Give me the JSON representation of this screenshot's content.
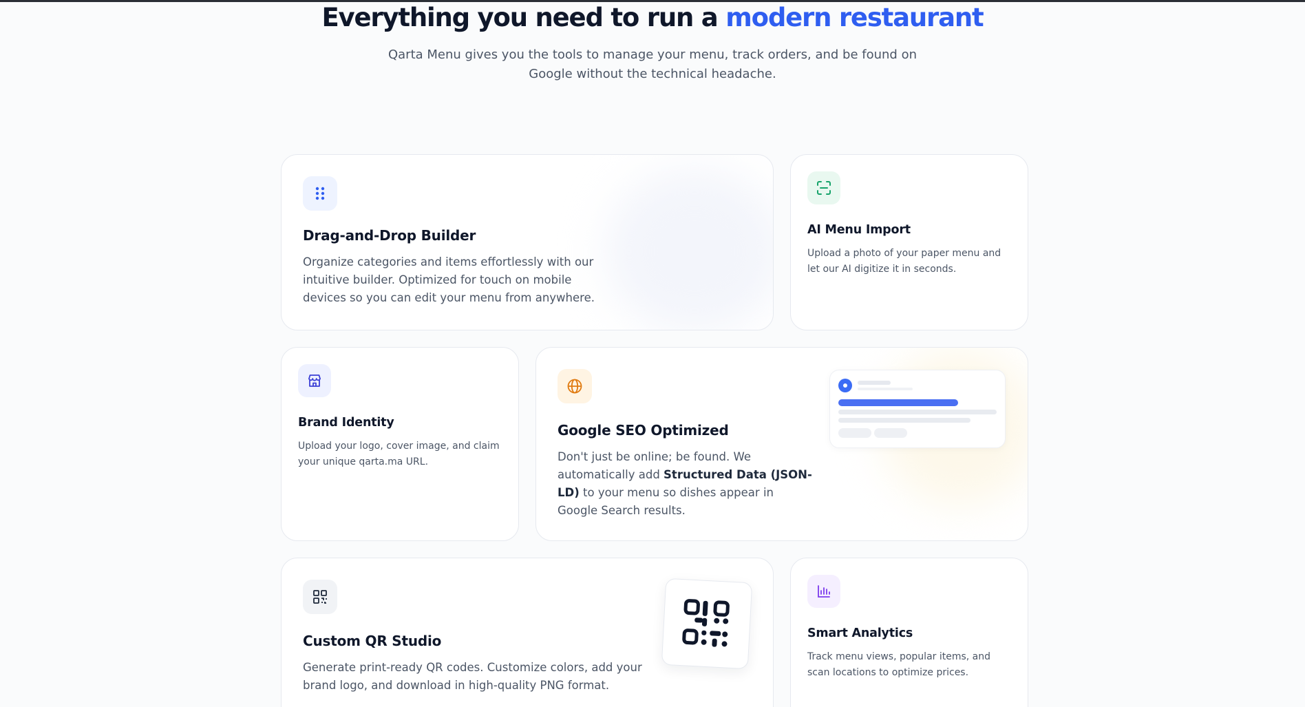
{
  "hero": {
    "title_main": "Everything you need to run a ",
    "title_accent": "modern restaurant",
    "subtitle": "Qarta Menu gives you the tools to manage your menu, track orders, and be found on Google without the technical headache."
  },
  "features": {
    "drag": {
      "title": "Drag-and-Drop Builder",
      "description": "Organize categories and items effortlessly with our intuitive builder. Optimized for touch on mobile devices so you can edit your menu from anywhere.",
      "icon": "grip-dots-icon"
    },
    "ai": {
      "title": "AI Menu Import",
      "description": "Upload a photo of your paper menu and let our AI digitize it in seconds.",
      "icon": "scan-icon"
    },
    "brand": {
      "title": "Brand Identity",
      "description": "Upload your logo, cover image, and claim your unique qarta.ma URL.",
      "icon": "store-icon"
    },
    "seo": {
      "title": "Google SEO Optimized",
      "description_before": "Don't just be online; be found. We automatically add ",
      "description_bold": "Structured Data (JSON-LD)",
      "description_after": " to your menu so dishes appear in Google Search results.",
      "icon": "globe-icon"
    },
    "qr": {
      "title": "Custom QR Studio",
      "description": "Generate print-ready QR codes. Customize colors, add your brand logo, and download in high-quality PNG format.",
      "icon": "qr-code-icon"
    },
    "analytics": {
      "title": "Smart Analytics",
      "description": "Track menu views, popular items, and scan locations to optimize prices.",
      "icon": "bar-chart-icon"
    }
  },
  "colors": {
    "accent": "#2f5ef0",
    "heading": "#0f172a",
    "body": "#4b5565",
    "ai_icon": "#16a36a",
    "seo_icon": "#e07a10",
    "analytics_icon": "#7c3aed"
  }
}
